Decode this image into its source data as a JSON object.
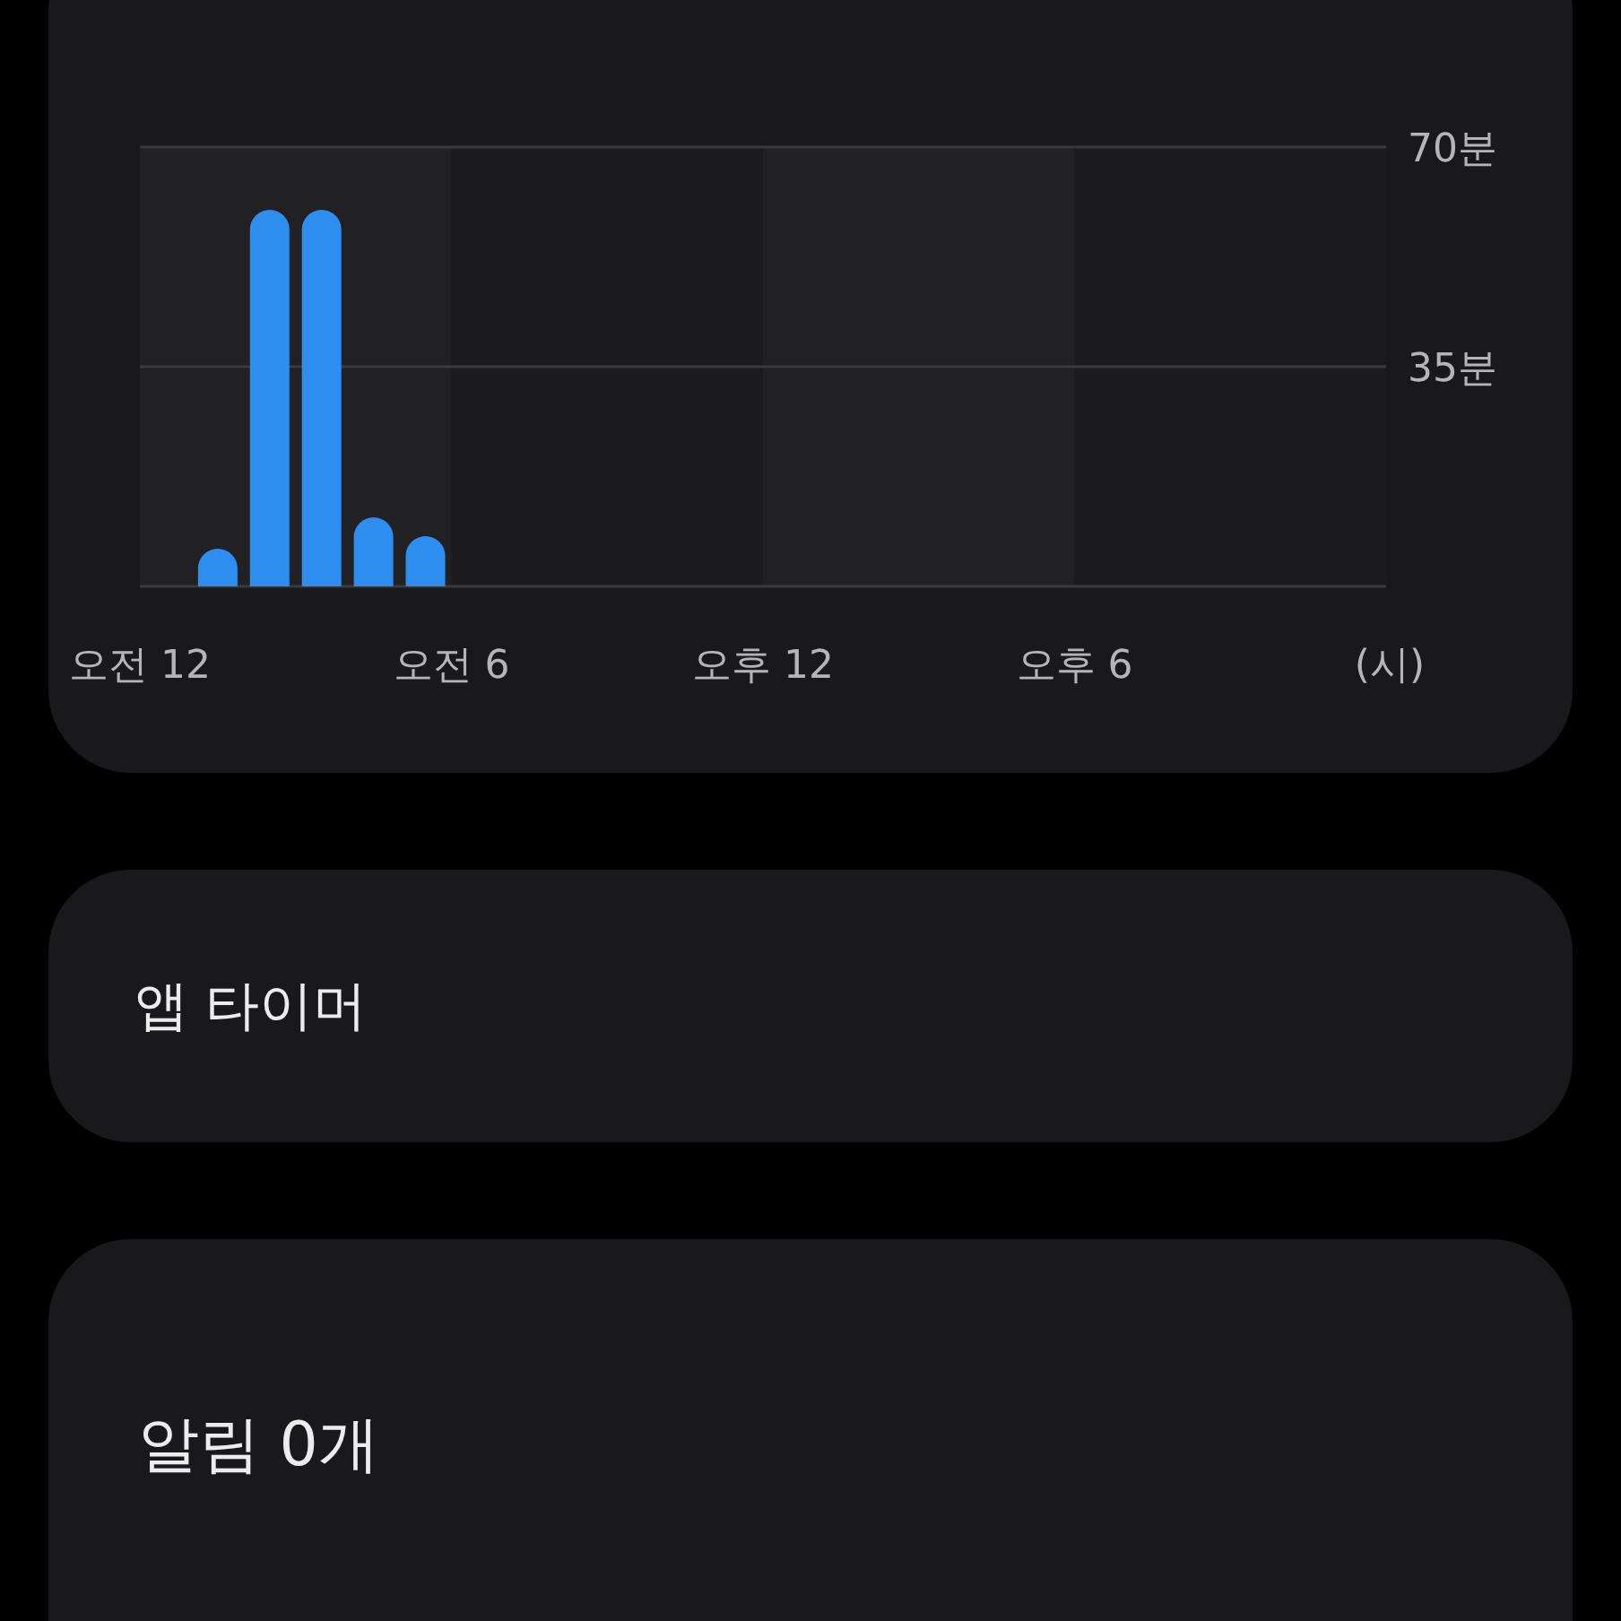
{
  "usage_card": {
    "chart_data": {
      "type": "bar",
      "xlabel": "(시)",
      "categories": [
        "오전 12",
        null,
        null,
        null,
        null,
        null,
        "오전 6",
        null,
        null,
        null,
        null,
        null,
        "오후 12",
        null,
        null,
        null,
        null,
        null,
        "오후 6",
        null,
        null,
        null,
        null,
        null
      ],
      "series": [
        {
          "color": "#2d8ef0",
          "values": [
            0,
            6,
            60,
            60,
            11,
            8,
            0,
            0,
            0,
            0,
            0,
            0,
            0,
            0,
            0,
            0,
            0,
            0,
            0,
            0,
            0,
            0,
            0,
            0
          ]
        }
      ],
      "ylim": [
        0,
        70
      ],
      "yticks": [
        {
          "value": 35,
          "label": "35분"
        },
        {
          "value": 70,
          "label": "70분"
        }
      ]
    }
  },
  "app_timer_card": {
    "title": "앱 타이머"
  },
  "notifications_card": {
    "title": "알림 0개"
  }
}
